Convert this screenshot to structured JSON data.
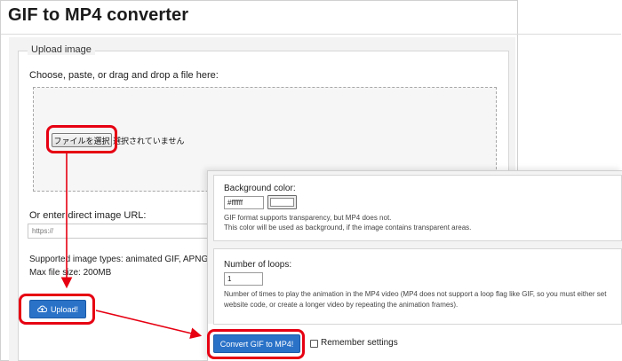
{
  "app": {
    "title": "GIF to MP4 converter"
  },
  "upload_section": {
    "legend": "Upload image",
    "choose_label": "Choose, paste, or drag and drop a file here:",
    "file_button_label": "ファイルを選択",
    "file_status": "選択されていません",
    "url_label": "Or enter direct image URL:",
    "url_placeholder": "https://",
    "supported_types": "Supported image types: animated GIF, APNG, MNG",
    "max_size": "Max file size: 200MB",
    "upload_button_label": "Upload!",
    "upload_icon": "cloud-upload-icon"
  },
  "options": {
    "background_label": "Background color:",
    "background_value": "#ffffff",
    "background_note_1": "GIF format supports transparency, but MP4 does not.",
    "background_note_2": "This color will be used as background, if the image contains transparent areas.",
    "loops_label": "Number of loops:",
    "loops_value": "1",
    "loops_note_1": "Number of times to play the animation in the MP4 video (MP4 does not support a loop flag like GIF, so you must either set",
    "loops_note_2": "website code, or create a longer video by repeating the animation frames).",
    "convert_button_label": "Convert GIF to MP4!",
    "remember_label": "Remember settings",
    "remember_checked": false
  },
  "colors": {
    "primary_button": "#2a72c8",
    "annotation_red": "#e60012"
  }
}
